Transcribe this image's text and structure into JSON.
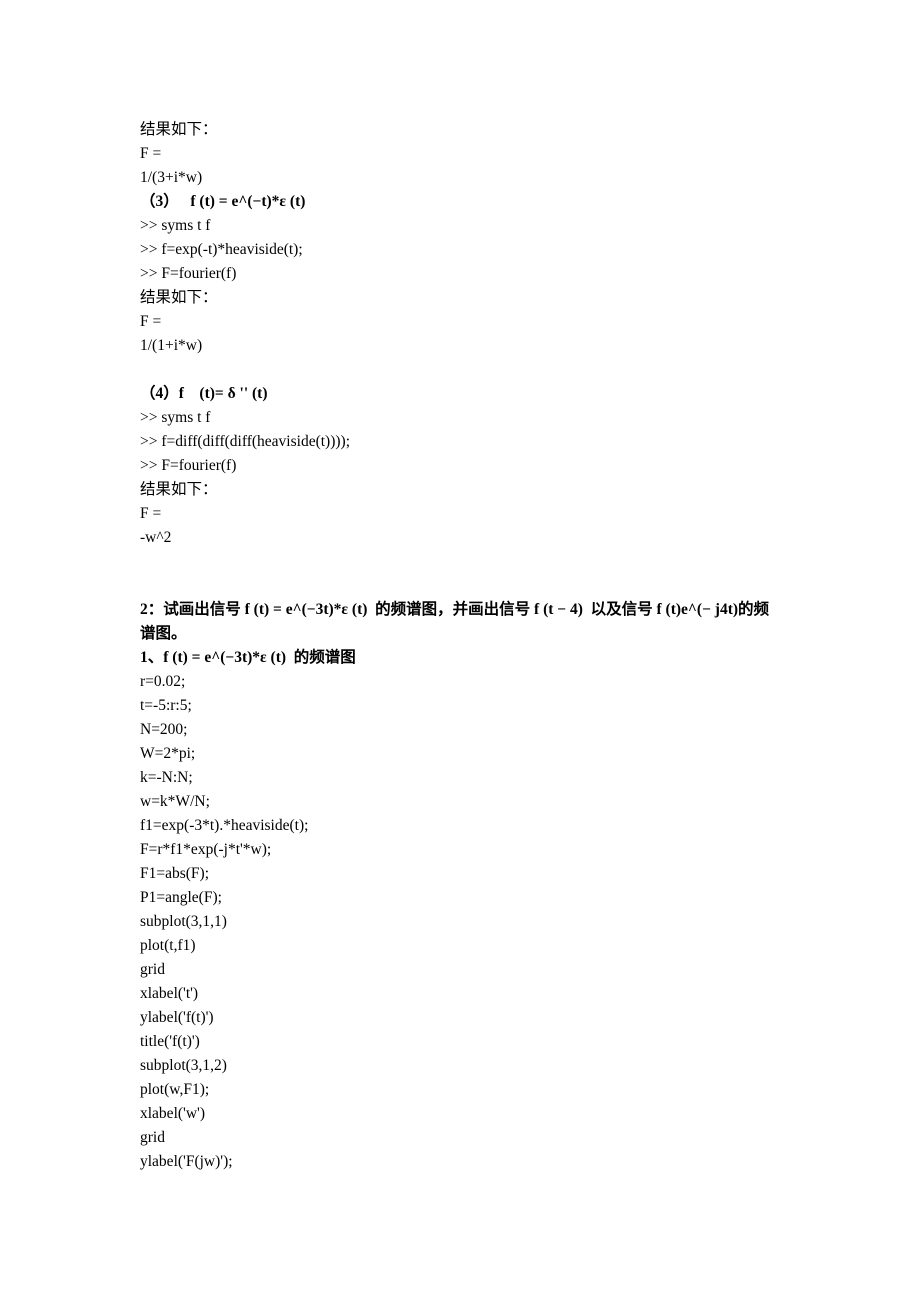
{
  "block1": {
    "l1": "结果如下：",
    "l2": "F =",
    "l3": "1/(3+i*w)",
    "l4": "（3）   f (t) = e^(−t)*ε (t)",
    "l5": ">> syms t f",
    "l6": ">> f=exp(-t)*heaviside(t);",
    "l7": ">> F=fourier(f)",
    "l8": "结果如下：",
    "l9": "F =",
    "l10": "1/(1+i*w)"
  },
  "block2": {
    "l1": "（4）f    (t)= δ '' (t)",
    "l2": ">> syms t f",
    "l3": ">> f=diff(diff(diff(heaviside(t))));",
    "l4": ">> F=fourier(f)",
    "l5": "结果如下：",
    "l6": "F =",
    "l7": "-w^2"
  },
  "block3": {
    "l1": "2：试画出信号 f (t) = e^(−3t)*ε (t)  的频谱图，并画出信号 f (t − 4)  以及信号 f (t)e^(− j4t)的频谱图。",
    "l2": "1、f (t) = e^(−3t)*ε (t)  的频谱图",
    "l3": "r=0.02;",
    "l4": "t=-5:r:5;",
    "l5": "N=200;",
    "l6": "W=2*pi;",
    "l7": "k=-N:N;",
    "l8": "w=k*W/N;",
    "l9": "f1=exp(-3*t).*heaviside(t);",
    "l10": "F=r*f1*exp(-j*t'*w);",
    "l11": "F1=abs(F);",
    "l12": "P1=angle(F);",
    "l13": "subplot(3,1,1)",
    "l14": "plot(t,f1)",
    "l15": "grid",
    "l16": "xlabel('t')",
    "l17": "ylabel('f(t)')",
    "l18": "title('f(t)')",
    "l19": "subplot(3,1,2)",
    "l20": "plot(w,F1);",
    "l21": "xlabel('w')",
    "l22": "grid",
    "l23": "ylabel('F(jw)');"
  }
}
